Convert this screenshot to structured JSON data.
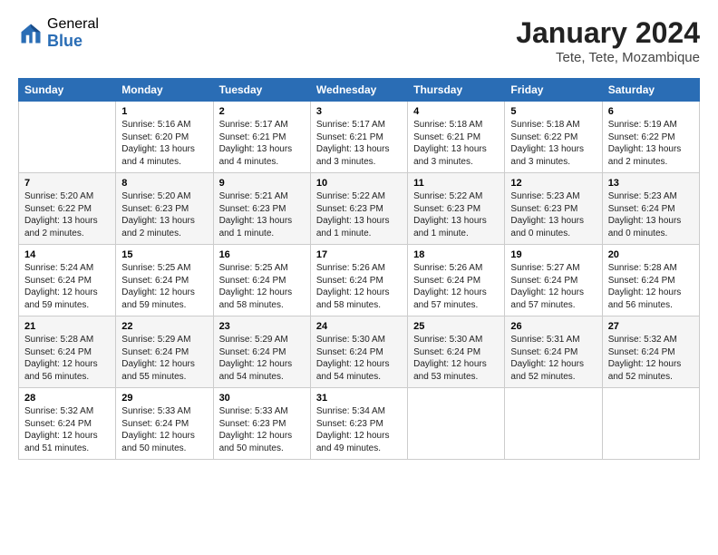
{
  "logo": {
    "general": "General",
    "blue": "Blue"
  },
  "title": "January 2024",
  "subtitle": "Tete, Tete, Mozambique",
  "header_days": [
    "Sunday",
    "Monday",
    "Tuesday",
    "Wednesday",
    "Thursday",
    "Friday",
    "Saturday"
  ],
  "weeks": [
    [
      {
        "day": "",
        "info": ""
      },
      {
        "day": "1",
        "info": "Sunrise: 5:16 AM\nSunset: 6:20 PM\nDaylight: 13 hours\nand 4 minutes."
      },
      {
        "day": "2",
        "info": "Sunrise: 5:17 AM\nSunset: 6:21 PM\nDaylight: 13 hours\nand 4 minutes."
      },
      {
        "day": "3",
        "info": "Sunrise: 5:17 AM\nSunset: 6:21 PM\nDaylight: 13 hours\nand 3 minutes."
      },
      {
        "day": "4",
        "info": "Sunrise: 5:18 AM\nSunset: 6:21 PM\nDaylight: 13 hours\nand 3 minutes."
      },
      {
        "day": "5",
        "info": "Sunrise: 5:18 AM\nSunset: 6:22 PM\nDaylight: 13 hours\nand 3 minutes."
      },
      {
        "day": "6",
        "info": "Sunrise: 5:19 AM\nSunset: 6:22 PM\nDaylight: 13 hours\nand 2 minutes."
      }
    ],
    [
      {
        "day": "7",
        "info": "Sunrise: 5:20 AM\nSunset: 6:22 PM\nDaylight: 13 hours\nand 2 minutes."
      },
      {
        "day": "8",
        "info": "Sunrise: 5:20 AM\nSunset: 6:23 PM\nDaylight: 13 hours\nand 2 minutes."
      },
      {
        "day": "9",
        "info": "Sunrise: 5:21 AM\nSunset: 6:23 PM\nDaylight: 13 hours\nand 1 minute."
      },
      {
        "day": "10",
        "info": "Sunrise: 5:22 AM\nSunset: 6:23 PM\nDaylight: 13 hours\nand 1 minute."
      },
      {
        "day": "11",
        "info": "Sunrise: 5:22 AM\nSunset: 6:23 PM\nDaylight: 13 hours\nand 1 minute."
      },
      {
        "day": "12",
        "info": "Sunrise: 5:23 AM\nSunset: 6:23 PM\nDaylight: 13 hours\nand 0 minutes."
      },
      {
        "day": "13",
        "info": "Sunrise: 5:23 AM\nSunset: 6:24 PM\nDaylight: 13 hours\nand 0 minutes."
      }
    ],
    [
      {
        "day": "14",
        "info": "Sunrise: 5:24 AM\nSunset: 6:24 PM\nDaylight: 12 hours\nand 59 minutes."
      },
      {
        "day": "15",
        "info": "Sunrise: 5:25 AM\nSunset: 6:24 PM\nDaylight: 12 hours\nand 59 minutes."
      },
      {
        "day": "16",
        "info": "Sunrise: 5:25 AM\nSunset: 6:24 PM\nDaylight: 12 hours\nand 58 minutes."
      },
      {
        "day": "17",
        "info": "Sunrise: 5:26 AM\nSunset: 6:24 PM\nDaylight: 12 hours\nand 58 minutes."
      },
      {
        "day": "18",
        "info": "Sunrise: 5:26 AM\nSunset: 6:24 PM\nDaylight: 12 hours\nand 57 minutes."
      },
      {
        "day": "19",
        "info": "Sunrise: 5:27 AM\nSunset: 6:24 PM\nDaylight: 12 hours\nand 57 minutes."
      },
      {
        "day": "20",
        "info": "Sunrise: 5:28 AM\nSunset: 6:24 PM\nDaylight: 12 hours\nand 56 minutes."
      }
    ],
    [
      {
        "day": "21",
        "info": "Sunrise: 5:28 AM\nSunset: 6:24 PM\nDaylight: 12 hours\nand 56 minutes."
      },
      {
        "day": "22",
        "info": "Sunrise: 5:29 AM\nSunset: 6:24 PM\nDaylight: 12 hours\nand 55 minutes."
      },
      {
        "day": "23",
        "info": "Sunrise: 5:29 AM\nSunset: 6:24 PM\nDaylight: 12 hours\nand 54 minutes."
      },
      {
        "day": "24",
        "info": "Sunrise: 5:30 AM\nSunset: 6:24 PM\nDaylight: 12 hours\nand 54 minutes."
      },
      {
        "day": "25",
        "info": "Sunrise: 5:30 AM\nSunset: 6:24 PM\nDaylight: 12 hours\nand 53 minutes."
      },
      {
        "day": "26",
        "info": "Sunrise: 5:31 AM\nSunset: 6:24 PM\nDaylight: 12 hours\nand 52 minutes."
      },
      {
        "day": "27",
        "info": "Sunrise: 5:32 AM\nSunset: 6:24 PM\nDaylight: 12 hours\nand 52 minutes."
      }
    ],
    [
      {
        "day": "28",
        "info": "Sunrise: 5:32 AM\nSunset: 6:24 PM\nDaylight: 12 hours\nand 51 minutes."
      },
      {
        "day": "29",
        "info": "Sunrise: 5:33 AM\nSunset: 6:24 PM\nDaylight: 12 hours\nand 50 minutes."
      },
      {
        "day": "30",
        "info": "Sunrise: 5:33 AM\nSunset: 6:23 PM\nDaylight: 12 hours\nand 50 minutes."
      },
      {
        "day": "31",
        "info": "Sunrise: 5:34 AM\nSunset: 6:23 PM\nDaylight: 12 hours\nand 49 minutes."
      },
      {
        "day": "",
        "info": ""
      },
      {
        "day": "",
        "info": ""
      },
      {
        "day": "",
        "info": ""
      }
    ]
  ]
}
